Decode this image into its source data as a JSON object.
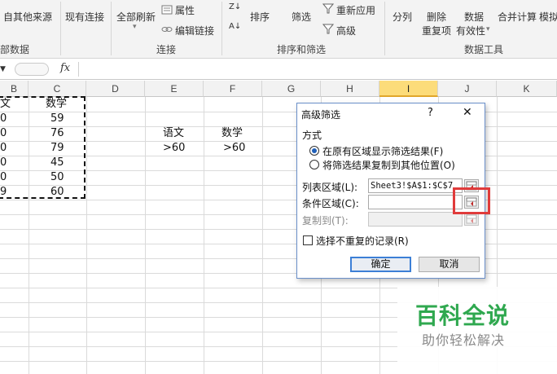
{
  "ribbon": {
    "from_other_sources": "自其他来源",
    "existing_connections": "现有连接",
    "refresh_all": "全部刷新",
    "properties": "属性",
    "edit_links": "编辑链接",
    "sort": "排序",
    "filter": "筛选",
    "reapply": "重新应用",
    "advanced": "高级",
    "split": "分列",
    "remove_dup_1": "删除",
    "remove_dup_2": "重复项",
    "validation_1": "数据",
    "validation_2": "有效性",
    "consolidate": "合并计算",
    "whatif": "模拟",
    "groups": {
      "external_data": "部数据",
      "connections": "连接",
      "sort_filter": "排序和筛选",
      "data_tools": "数据工具"
    },
    "sort_az_icon_text": "Z↓",
    "sort_za_icon_text": "A↓"
  },
  "formula_bar": {
    "fx": "fx",
    "value": ""
  },
  "grid": {
    "columns": [
      "B",
      "C",
      "D",
      "E",
      "F",
      "G",
      "H",
      "I",
      "J",
      "K"
    ],
    "selected_column": "I",
    "source_data": {
      "header_b": "文",
      "header_c": "数学",
      "b_values": [
        "0",
        "0",
        "0",
        "0",
        "0",
        "9"
      ],
      "c_values": [
        "59",
        "76",
        "79",
        "45",
        "50",
        "60"
      ]
    },
    "criteria": {
      "e_header": "语文",
      "f_header": "数学",
      "e_value": ">60",
      "f_value": ">60"
    }
  },
  "dialog": {
    "title": "高级筛选",
    "help": "?",
    "close": "✕",
    "mode_label": "方式",
    "option_in_place": "在原有区域显示筛选结果(F)",
    "option_copy": "将筛选结果复制到其他位置(O)",
    "list_range_label": "列表区域(L):",
    "list_range_value": "Sheet3!$A$1:$C$7",
    "criteria_range_label": "条件区域(C):",
    "criteria_range_value": "",
    "copy_to_label": "复制到(T):",
    "copy_to_value": "",
    "unique_label": "选择不重复的记录(R)",
    "ok": "确定",
    "cancel": "取消"
  },
  "watermark": {
    "title": "百科全说",
    "subtitle": "助你轻松解决"
  },
  "colors": {
    "selected_header": "#fcdc7a",
    "highlight_box": "#e03b3b",
    "watermark_green": "#2fa84f",
    "accent_blue": "#1f5fb8"
  }
}
